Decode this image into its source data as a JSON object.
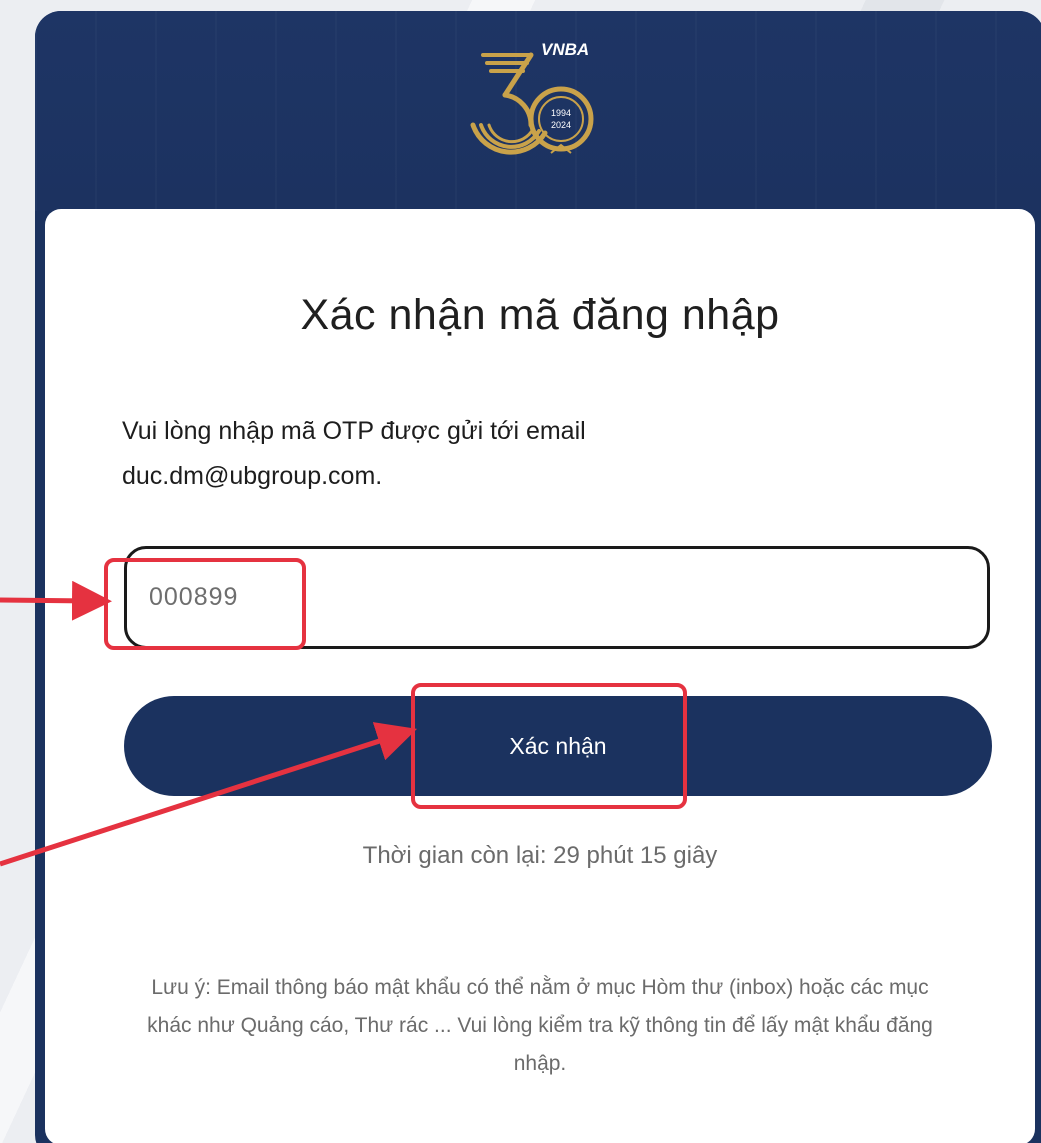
{
  "header": {
    "logo_text": "VNBA",
    "logo_years": [
      "1994",
      "2024"
    ]
  },
  "form": {
    "title": "Xác nhận mã đăng nhập",
    "instruction_line1": "Vui lòng nhập mã OTP được gửi tới email",
    "instruction_line2": "duc.dm@ubgroup.com.",
    "otp_value": "000899",
    "submit_label": "Xác nhận",
    "timer_text": "Thời gian còn lại: 29 phút 15 giây",
    "note_text": "Lưu ý: Email thông báo mật khẩu có thể nằm ở mục Hòm thư (inbox) hoặc các mục khác như Quảng cáo, Thư rác ... Vui lòng kiểm tra kỹ thông tin để lấy mật khẩu đăng nhập."
  },
  "colors": {
    "brand_navy": "#1b325f",
    "gold": "#c9a24a",
    "annotation_red": "#e53240"
  }
}
